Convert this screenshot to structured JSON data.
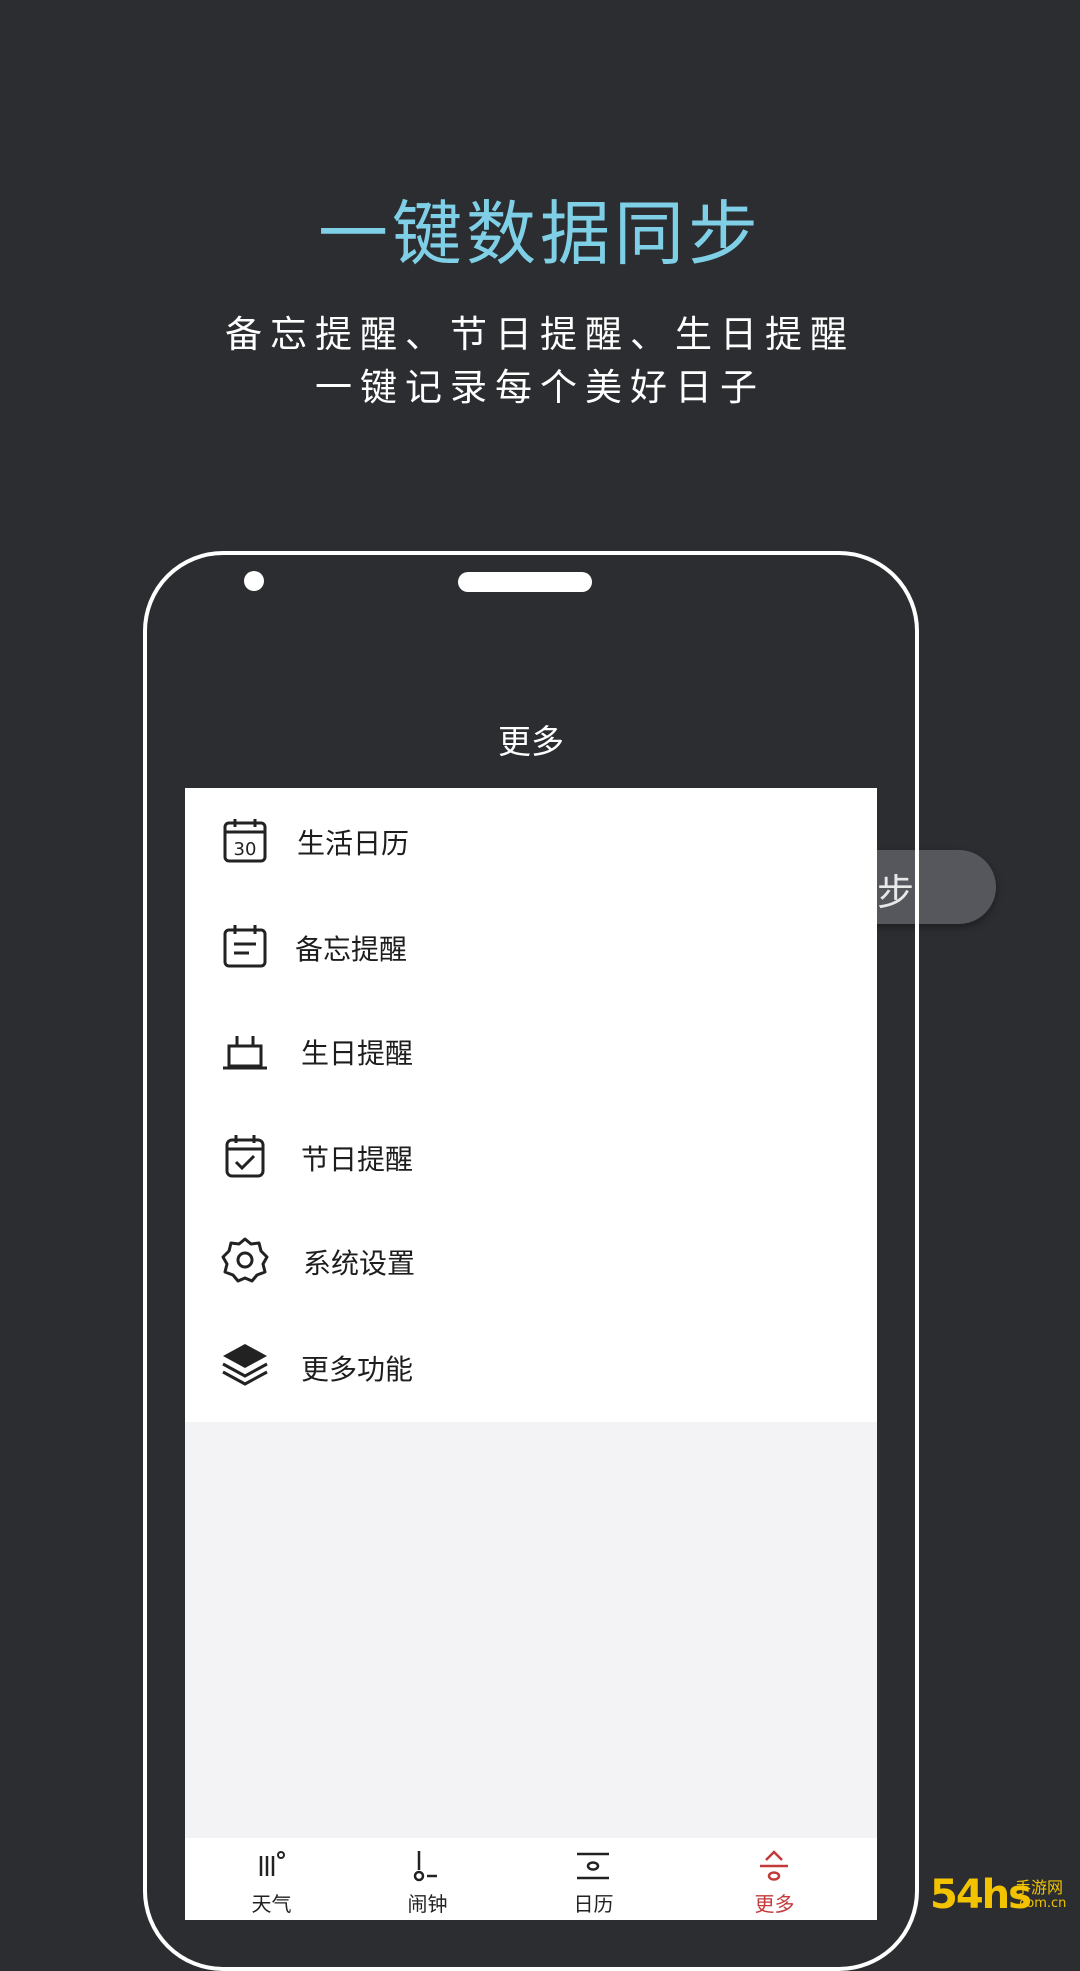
{
  "promo": {
    "headline": "一键数据同步",
    "subline1": "备忘提醒、节日提醒、生日提醒",
    "subline2": "一键记录每个美好日子",
    "peek_text": "步"
  },
  "app": {
    "title": "更多",
    "menu": [
      {
        "label": "生活日历",
        "icon": "calendar-30-icon",
        "badge": "30"
      },
      {
        "label": "备忘提醒",
        "icon": "memo-icon"
      },
      {
        "label": "生日提醒",
        "icon": "birthday-cake-icon"
      },
      {
        "label": "节日提醒",
        "icon": "calendar-check-icon"
      },
      {
        "label": "系统设置",
        "icon": "gear-icon"
      },
      {
        "label": "更多功能",
        "icon": "layers-icon"
      }
    ],
    "tabs": [
      {
        "label": "天气",
        "icon": "weather-icon"
      },
      {
        "label": "闹钟",
        "icon": "alarm-icon"
      },
      {
        "label": "日历",
        "icon": "calendar-icon"
      },
      {
        "label": "更多",
        "icon": "more-icon",
        "active": true
      }
    ],
    "accent": "#c23a3a"
  },
  "watermark": {
    "brand": "54hs",
    "name": "手游网",
    "domain": ".com.cn"
  },
  "colors": {
    "background": "#2b2d31",
    "headline": "#7fd0e6"
  }
}
